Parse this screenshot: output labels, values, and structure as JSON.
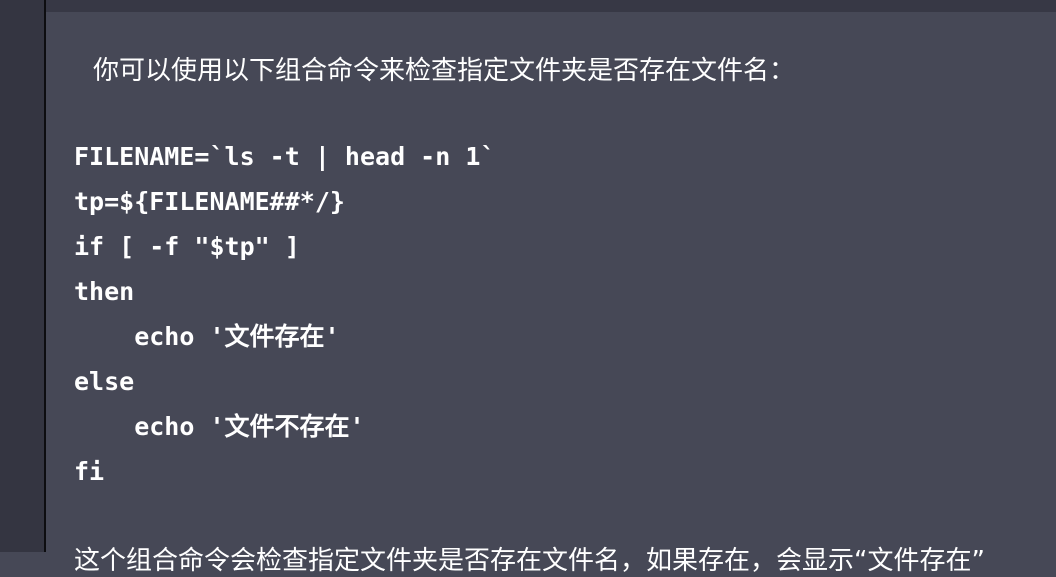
{
  "message": {
    "intro": "你可以使用以下组合命令来检查指定文件夹是否存在文件名：",
    "code_lines": [
      "FILENAME=`ls -t | head -n 1`",
      "tp=${FILENAME##*/}",
      "if [ -f \"$tp\" ]",
      "then",
      "    echo '文件存在'",
      "else",
      "    echo '文件不存在'",
      "fi"
    ],
    "outro": "这个组合命令会检查指定文件夹是否存在文件名，如果存在，会显示“文件存在”"
  }
}
